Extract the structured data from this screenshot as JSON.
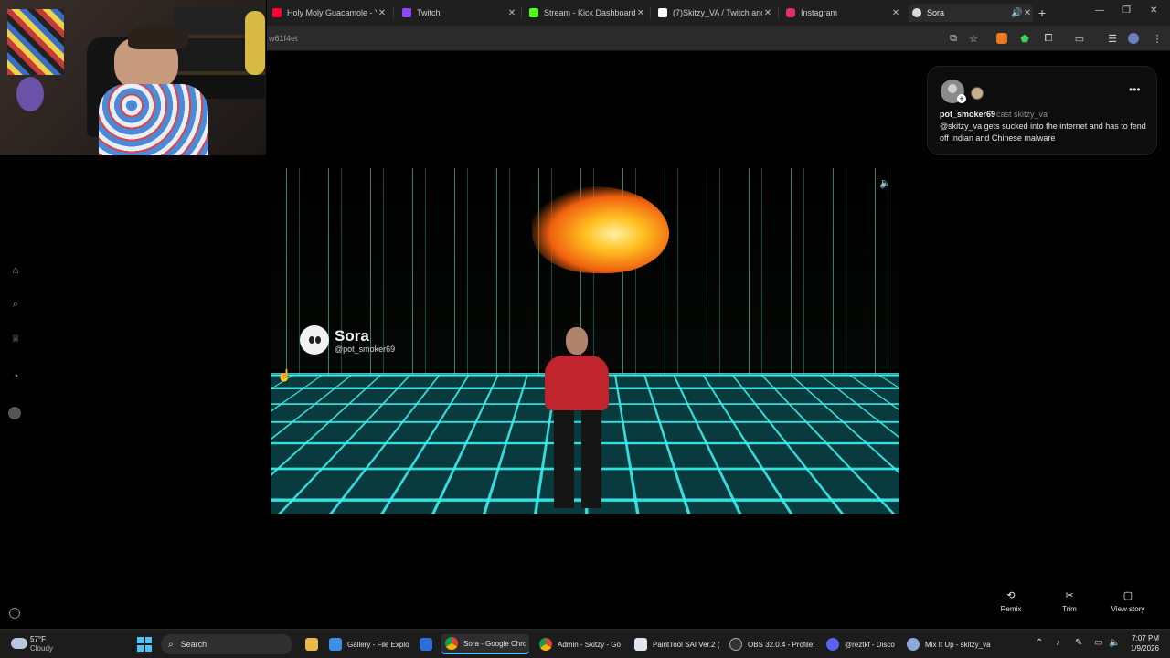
{
  "browser": {
    "tabs": [
      {
        "title": "Holy Moly Guacamole - Y",
        "icon": "youtube-icon",
        "color": "#ff0033"
      },
      {
        "title": "Twitch",
        "icon": "twitch-icon",
        "color": "#9146ff"
      },
      {
        "title": "Stream - Kick Dashboard",
        "icon": "kick-icon",
        "color": "#53fc18"
      },
      {
        "title": "(7)Skitzy_VA / Twitch and",
        "icon": "tiktok-icon",
        "color": "#ffffff"
      },
      {
        "title": "Instagram",
        "icon": "instagram-icon",
        "color": "#e1306c"
      },
      {
        "title": "Sora",
        "icon": "sora-icon",
        "color": "#d9d9d9"
      }
    ],
    "url": "w61f4et",
    "window_controls": {
      "minimize": "—",
      "maximize": "❐",
      "close": "✕"
    }
  },
  "video": {
    "brand": "Sora",
    "handle": "@pot_smoker69"
  },
  "comment_card": {
    "username": "pot_smoker69",
    "cast_text": "cast skitzy_va",
    "caption": "@skitzy_va gets sucked into the internet and has to fend off Indian and Chinese malware"
  },
  "actions": [
    {
      "label": "Remix",
      "icon": "remix-icon"
    },
    {
      "label": "Trim",
      "icon": "scissors-icon"
    },
    {
      "label": "View story",
      "icon": "story-icon"
    }
  ],
  "taskbar": {
    "weather": {
      "temp": "57°F",
      "desc": "Cloudy"
    },
    "search_label": "Search",
    "apps": [
      {
        "label": "",
        "icon": "file-explorer-icon"
      },
      {
        "label": "Gallery - File Explo",
        "icon": "gallery-icon"
      },
      {
        "label": "",
        "icon": "photos-icon"
      },
      {
        "label": "Sora - Google Chro",
        "icon": "chrome-icon"
      },
      {
        "label": "Admin - Skitzy - Go",
        "icon": "chrome-icon"
      },
      {
        "label": "PaintTool SAI Ver.2 (",
        "icon": "painttool-icon"
      },
      {
        "label": "OBS 32.0.4 - Profile:",
        "icon": "obs-icon"
      },
      {
        "label": "@reztkf - Disco",
        "icon": "discord-icon"
      },
      {
        "label": "Mix It Up - skitzy_va",
        "icon": "mixitup-icon"
      }
    ],
    "time": "7:07 PM",
    "date": "1/9/2026"
  },
  "colors": {
    "accent": "#4cc2ff",
    "floor_grid": "#3cf0f0",
    "rain": "#6effc8",
    "shirt": "#c0242c"
  }
}
